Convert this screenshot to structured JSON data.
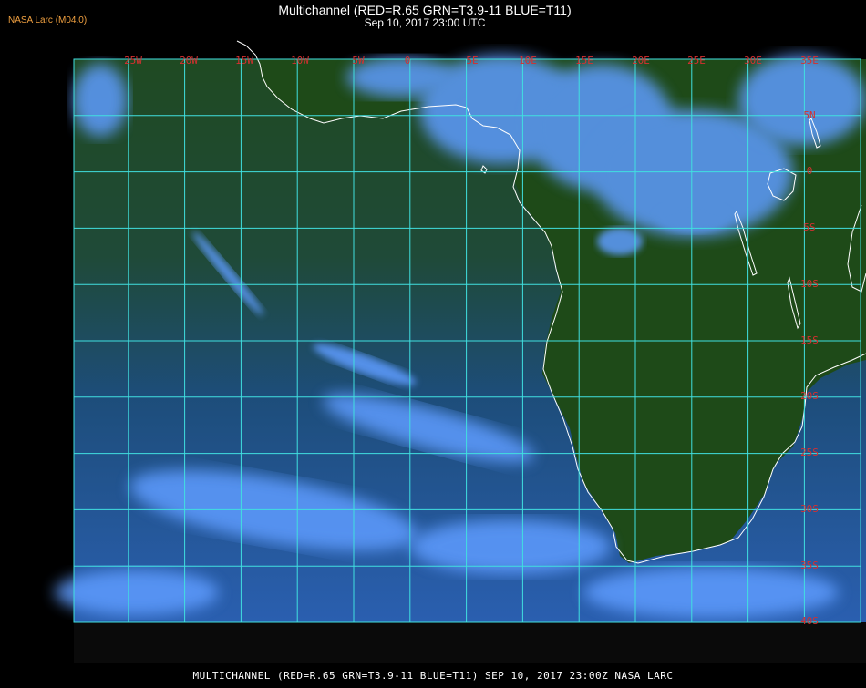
{
  "header": {
    "agency": "NASA Larc (M04.0)",
    "title": "Multichannel (RED=R.65 GRN=T3.9-11 BLUE=T11)",
    "datetime": "Sep 10, 2017 23:00 UTC"
  },
  "map": {
    "lon_labels": [
      "25W",
      "20W",
      "15W",
      "10W",
      "5W",
      "0",
      "5E",
      "10E",
      "15E",
      "20E",
      "25E",
      "30E",
      "35E"
    ],
    "lat_labels": [
      "5N",
      "0",
      "5S",
      "10S",
      "15S",
      "20S",
      "25S",
      "30S",
      "35S",
      "40S"
    ],
    "grid_color": "#40e0e0",
    "label_color": "#d63030",
    "coast_color": "#ffffff",
    "land_color": "#1f4a18",
    "ocean_color": "#1e4a8a",
    "cloud_color": "#6aa8ff"
  },
  "footer": {
    "caption": "MULTICHANNEL (RED=R.65 GRN=T3.9-11 BLUE=T11) SEP 10, 2017 23:00Z   NASA LARC"
  }
}
